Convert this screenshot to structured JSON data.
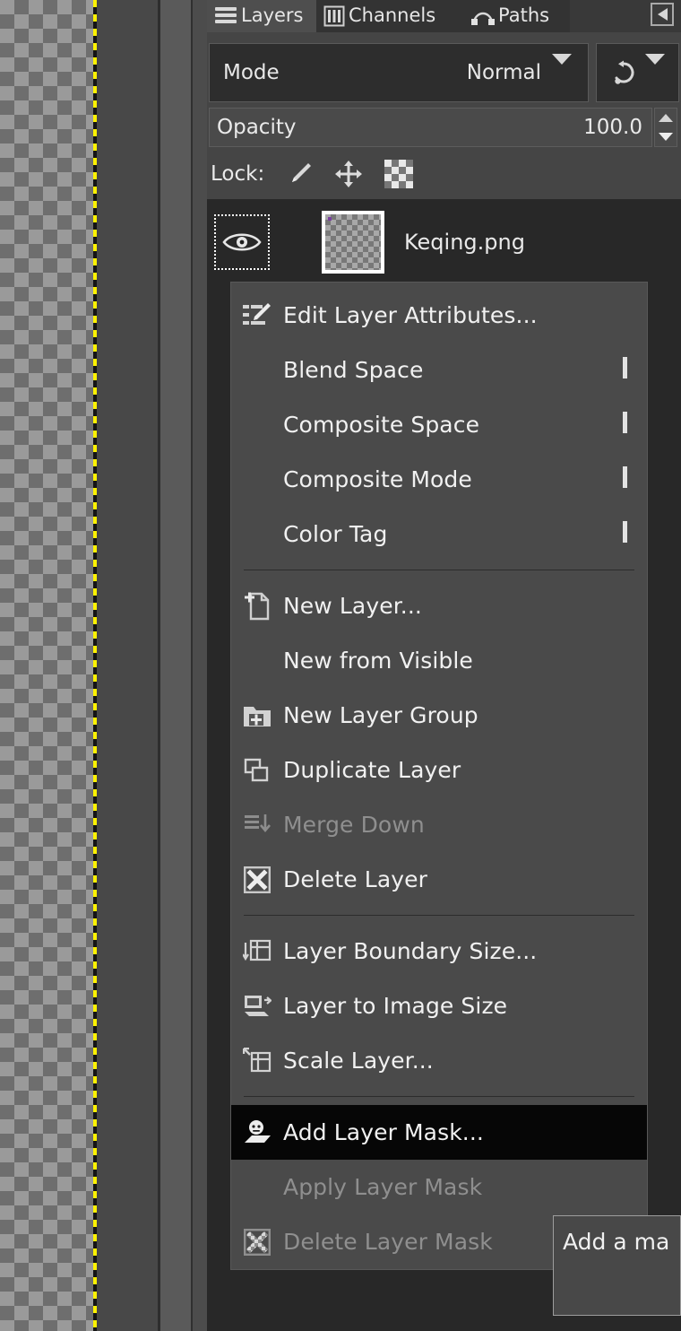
{
  "app": "GIMP",
  "canvas": {
    "transparency": "checkerboard",
    "boundary": "yellow-black dashed layer boundary"
  },
  "dock": {
    "tabs": [
      {
        "label": "Layers",
        "icon": "layers-icon",
        "active": true
      },
      {
        "label": "Channels",
        "icon": "channels-icon",
        "active": false
      },
      {
        "label": "Paths",
        "icon": "paths-icon",
        "active": false
      }
    ],
    "tab_menu_icon": "tab-menu-triangle-icon"
  },
  "mode": {
    "label": "Mode",
    "value": "Normal",
    "dropdown_icon": "chevron-down-icon",
    "reset_icon": "reset-to-default-icon"
  },
  "opacity": {
    "label": "Opacity",
    "value": "100.0",
    "spin_up_icon": "chevron-up-icon",
    "spin_down_icon": "chevron-down-icon"
  },
  "lock": {
    "label": "Lock:",
    "items": [
      {
        "icon": "paintbrush-icon",
        "name": "lock-pixels"
      },
      {
        "icon": "move-arrows-icon",
        "name": "lock-position"
      },
      {
        "icon": "alpha-checkerboard-icon",
        "name": "lock-alpha"
      }
    ]
  },
  "layer": {
    "name": "Keqing.png",
    "visible": true,
    "visibility_icon": "eye-icon",
    "thumbnail": "transparent-checkerboard"
  },
  "context_menu": {
    "groups": [
      [
        {
          "label": "Edit Layer Attributes...",
          "icon": "edit-attributes-icon",
          "enabled": true,
          "submenu": false
        },
        {
          "label": "Blend Space",
          "icon": null,
          "enabled": true,
          "submenu": true
        },
        {
          "label": "Composite Space",
          "icon": null,
          "enabled": true,
          "submenu": true
        },
        {
          "label": "Composite Mode",
          "icon": null,
          "enabled": true,
          "submenu": true
        },
        {
          "label": "Color Tag",
          "icon": null,
          "enabled": true,
          "submenu": true
        }
      ],
      [
        {
          "label": "New Layer...",
          "icon": "new-layer-icon",
          "enabled": true,
          "submenu": false
        },
        {
          "label": "New from Visible",
          "icon": null,
          "enabled": true,
          "submenu": false
        },
        {
          "label": "New Layer Group",
          "icon": "new-layer-group-icon",
          "enabled": true,
          "submenu": false
        },
        {
          "label": "Duplicate Layer",
          "icon": "duplicate-layer-icon",
          "enabled": true,
          "submenu": false
        },
        {
          "label": "Merge Down",
          "icon": "merge-down-icon",
          "enabled": false,
          "submenu": false
        },
        {
          "label": "Delete Layer",
          "icon": "delete-layer-icon",
          "enabled": true,
          "submenu": false
        }
      ],
      [
        {
          "label": "Layer Boundary Size...",
          "icon": "layer-boundary-size-icon",
          "enabled": true,
          "submenu": false
        },
        {
          "label": "Layer to Image Size",
          "icon": "layer-to-image-size-icon",
          "enabled": true,
          "submenu": false
        },
        {
          "label": "Scale Layer...",
          "icon": "scale-layer-icon",
          "enabled": true,
          "submenu": false
        }
      ],
      [
        {
          "label": "Add Layer Mask...",
          "icon": "add-layer-mask-icon",
          "enabled": true,
          "submenu": false,
          "highlighted": true
        },
        {
          "label": "Apply Layer Mask",
          "icon": null,
          "enabled": false,
          "submenu": false
        },
        {
          "label": "Delete Layer Mask",
          "icon": "delete-layer-mask-icon",
          "enabled": false,
          "submenu": false
        }
      ]
    ]
  },
  "tooltip": {
    "text": "Add a ma"
  },
  "colors": {
    "menu_bg": "#4a4a4a",
    "panel_bg": "#454545",
    "list_bg": "#282828",
    "highlight_bg": "#060606",
    "text": "#f1f1f1",
    "disabled_text": "#8f8f8f",
    "boundary_yellow": "#fff200"
  }
}
